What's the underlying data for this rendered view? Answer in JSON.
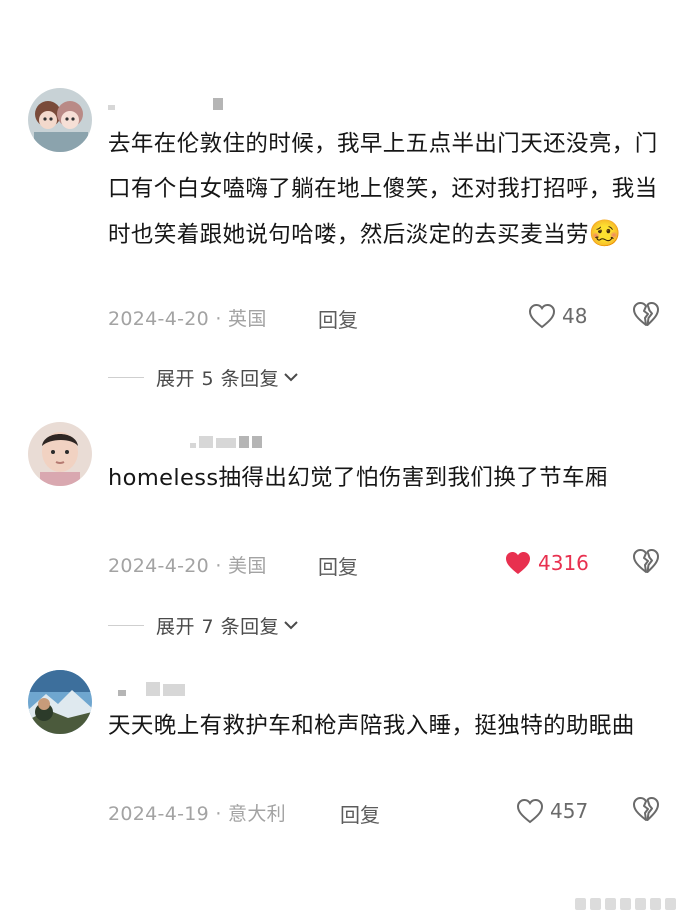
{
  "comments": [
    {
      "text": "去年在伦敦住的时候，我早上五点半出门天还没亮，门口有个白女嗑嗨了躺在地上傻笑，还对我打招呼，我当时也笑着跟她说句哈喽，然后淡定的去买麦当劳",
      "emoji": "🥴",
      "date_location": "2024-4-20 · 英国",
      "reply_label": "回复",
      "likes": "48",
      "liked": false,
      "expand_label": "展开 5 条回复"
    },
    {
      "text": "homeless抽得出幻觉了怕伤害到我们换了节车厢",
      "date_location": "2024-4-20 · 美国",
      "reply_label": "回复",
      "likes": "4316",
      "liked": true,
      "expand_label": "展开 7 条回复"
    },
    {
      "text": "天天晚上有救护车和枪声陪我入睡，挺独特的助眠曲",
      "date_location": "2024-4-19 · 意大利",
      "reply_label": "回复",
      "likes": "457",
      "liked": false
    }
  ],
  "colors": {
    "like_active": "#e8304f",
    "meta_text": "#a3a3a3",
    "body_text": "#161616"
  }
}
